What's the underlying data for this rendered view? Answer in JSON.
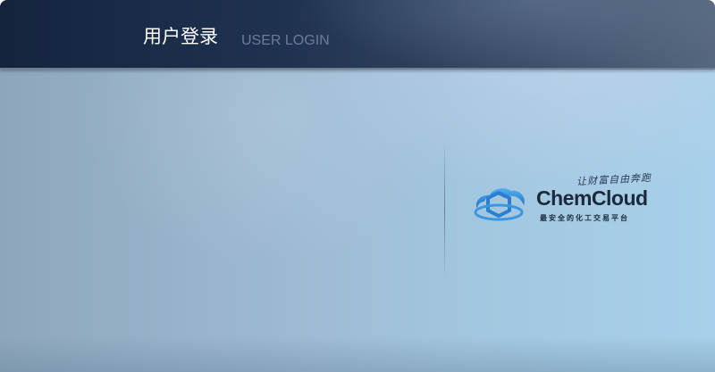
{
  "header": {
    "title": "用户登录",
    "subtitle": "USER LOGIN"
  },
  "brand": {
    "name": "ChemCloud",
    "slogan": "让财富自由奔跑",
    "tagline": "最安全的化工交易平台",
    "icon": "cloud-logo-icon",
    "color": "#2a86d6"
  }
}
